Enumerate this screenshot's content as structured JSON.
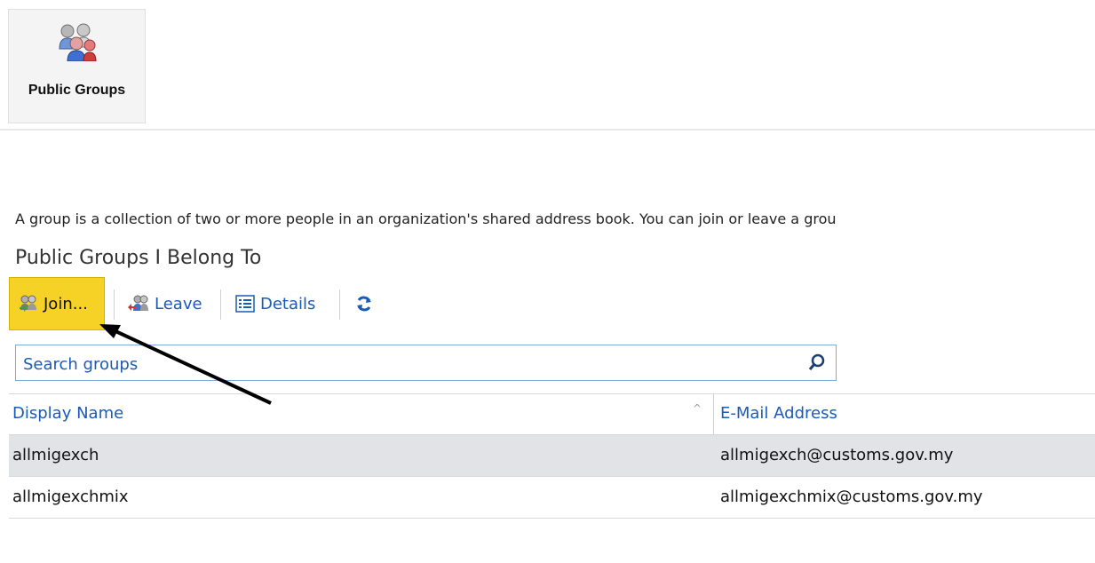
{
  "tile": {
    "label": "Public Groups",
    "icon": "people-group-icon"
  },
  "intro_text": "A group is a collection of two or more people in an organization's shared address book. You can join or leave a grou",
  "section_title": "Public Groups I Belong To",
  "toolbar": {
    "join_label": "Join...",
    "leave_label": "Leave",
    "details_label": "Details"
  },
  "search": {
    "placeholder": "Search groups",
    "value": ""
  },
  "table": {
    "columns": [
      "Display Name",
      "E-Mail Address"
    ],
    "rows": [
      {
        "name": "allmigexch",
        "email": "allmigexch@customs.gov.my",
        "selected": true
      },
      {
        "name": "allmigexchmix",
        "email": "allmigexchmix@customs.gov.my",
        "selected": false
      }
    ]
  },
  "colors": {
    "accent": "#1a5bb5",
    "highlight": "#f7d226",
    "selected_row": "#e1e3e6"
  }
}
